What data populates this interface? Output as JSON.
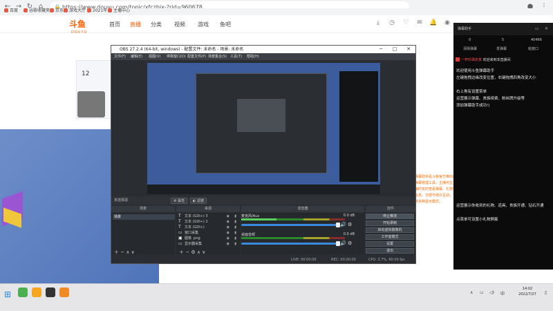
{
  "browser": {
    "url": "https://www.douyu.com/topic/xfczbjx-?rid=960678",
    "bookmarks": [
      "百度",
      "谷歌收藏夹",
      "京东",
      "游戏大厅",
      "2021年",
      "主播中心"
    ]
  },
  "site": {
    "logo": "斗鱼",
    "logo_sub": "DOUYU",
    "nav": [
      "首页",
      "直播",
      "分类",
      "视频",
      "游戏",
      "鱼吧"
    ],
    "level_number": "12",
    "right_text": "弹幕助手是斗鱼官方推出的弹幕管理工具，主播可在直播时实时查看弹幕、礼物等信息，方便与观众互动，支持多种显示模式。"
  },
  "obs": {
    "title": "OBS 27.2.4 (64-bit, windows) - 配置文件: 未命名 - 场景: 未命名",
    "menu": [
      "文件(F)",
      "编辑(E)",
      "视图(V)",
      "停靠窗口(D)",
      "配置文件(P)",
      "场景集合(S)",
      "工具(T)",
      "帮助(H)"
    ],
    "toolbar": {
      "current_label": "未选择源",
      "props_label": "属性",
      "filters_label": "滤镜"
    },
    "docks": {
      "scenes_title": "场景",
      "sources_title": "来源",
      "mixer_title": "混音器",
      "controls_title": "控件"
    },
    "scenes": [
      "场景"
    ],
    "sources": [
      {
        "icon": "T",
        "name": "文本 (GDI+) 3"
      },
      {
        "icon": "T",
        "name": "文本 (GDI+) 2"
      },
      {
        "icon": "T",
        "name": "文本 (GDI+)"
      },
      {
        "icon": "▭",
        "name": "窗口采集"
      },
      {
        "icon": "▣",
        "name": "图像 .png"
      },
      {
        "icon": "▭",
        "name": "显示器采集"
      }
    ],
    "mixer": [
      {
        "name": "麦克风/Aux",
        "db": "0.0 dB",
        "level": 0.34
      },
      {
        "name": "桌面音频",
        "db": "0.0 dB",
        "level": 0.0
      }
    ],
    "controls": [
      "停止推流",
      "开始录制",
      "启动虚拟摄像机",
      "工作室模式",
      "设置",
      "退出"
    ],
    "status": {
      "live": "LIVE: 00:00:00",
      "rec": "REC: 00:00:00",
      "cpu": "CPU: 3.7%, 60.00 fps"
    }
  },
  "chat": {
    "title": "弹幕助手",
    "stats": [
      "0",
      "5",
      "40466"
    ],
    "tabs": [
      "清除弹幕",
      "发弹幕",
      "粘窗口"
    ],
    "welcome_pre": "一杯珍珠奶茶",
    "welcome_post": "欢迎来到本直播间",
    "messages_top": [
      "欢迎使用斗鱼弹幕助手",
      "左键拖拽边缘改变位置，右键拖拽四角改变大小",
      "右上角有设置菜单",
      "运营展示弹幕、贵族续费、粉丝牌升级等",
      "添加弹幕助手成功!)"
    ],
    "messages_bottom": [
      "运营展示你收到的礼物、道具、贵族开通、钻石开通",
      "点菜单可设置小礼物屏蔽"
    ]
  },
  "taskbar": {
    "time": "14:02",
    "date": "2022/7/27"
  }
}
